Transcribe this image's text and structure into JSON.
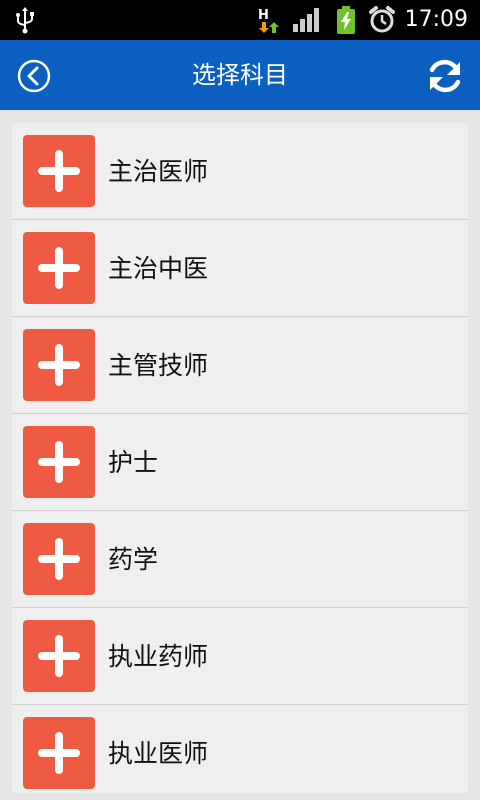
{
  "status_bar": {
    "time": "17:09",
    "network_type": "H"
  },
  "header": {
    "title": "选择科目"
  },
  "subjects": [
    {
      "label": "主治医师"
    },
    {
      "label": "主治中医"
    },
    {
      "label": "主管技师"
    },
    {
      "label": "护士"
    },
    {
      "label": "药学"
    },
    {
      "label": "执业药师"
    },
    {
      "label": "执业医师"
    }
  ],
  "colors": {
    "app_bar": "#0a5fc0",
    "plus_tile": "#ef5a43",
    "background": "#e6e6e6"
  }
}
